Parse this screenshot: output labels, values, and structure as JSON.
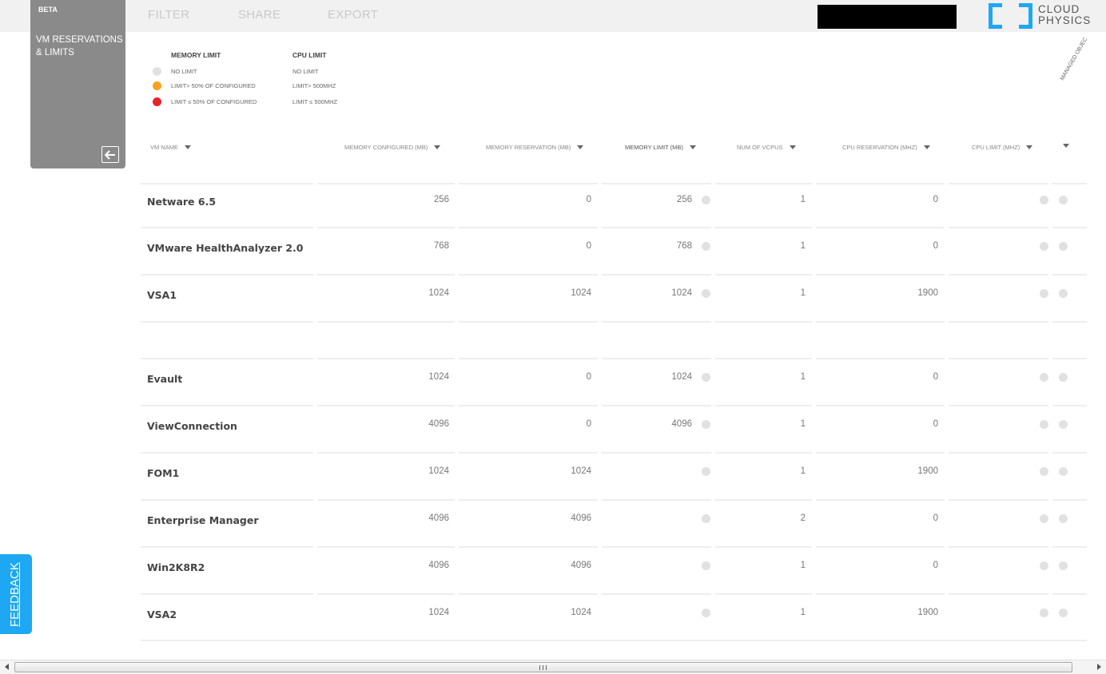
{
  "nav": {
    "filter": "FILTER",
    "share": "SHARE",
    "export": "EXPORT"
  },
  "logo": {
    "line1": "CLOUD",
    "line2": "PHYSICS",
    "color": "#1ea7f2"
  },
  "panel": {
    "badge": "BETA",
    "title": "VM RESERVATIONS & LIMITS"
  },
  "legend": {
    "memory_heading": "MEMORY LIMIT",
    "cpu_heading": "CPU LIMIT",
    "rows": [
      {
        "color": "#e1e1e1",
        "memory": "NO LIMIT",
        "cpu": "NO LIMIT"
      },
      {
        "color": "#f5a31c",
        "memory": "LIMIT> 50% OF CONFIGURED",
        "cpu": "LIMIT> 500MHZ"
      },
      {
        "color": "#e8232a",
        "memory": "LIMIT ≤ 50% OF CONFIGURED",
        "cpu": "LIMIT ≤ 500MHZ"
      }
    ]
  },
  "columns": {
    "vm_name": "VM NAME",
    "mem_configured": "MEMORY CONFIGURED (MB)",
    "mem_reservation": "MEMORY RESERVATION (MB)",
    "mem_limit": "MEMORY LIMIT (MB)",
    "num_vcpus": "NUM OF VCPUS",
    "cpu_reservation": "CPU RESERVATION (MHZ)",
    "cpu_limit": "CPU LIMIT (MHZ)",
    "managed_object": "MANAGED OBJECT REFERENCE"
  },
  "rows": [
    {
      "name": "Netware 6.5",
      "mem_configured": "256",
      "mem_reservation": "0",
      "mem_limit": "256",
      "vcpus": "1",
      "cpu_reservation": "0"
    },
    {
      "name": "VMware HealthAnalyzer 2.0",
      "mem_configured": "768",
      "mem_reservation": "0",
      "mem_limit": "768",
      "vcpus": "1",
      "cpu_reservation": "0"
    },
    {
      "name": "VSA1",
      "mem_configured": "1024",
      "mem_reservation": "1024",
      "mem_limit": "1024",
      "vcpus": "1",
      "cpu_reservation": "1900"
    },
    {
      "name": "",
      "mem_configured": "",
      "mem_reservation": "",
      "mem_limit": "",
      "vcpus": "",
      "cpu_reservation": ""
    },
    {
      "name": "Evault",
      "mem_configured": "1024",
      "mem_reservation": "0",
      "mem_limit": "1024",
      "vcpus": "1",
      "cpu_reservation": "0"
    },
    {
      "name": "ViewConnection",
      "mem_configured": "4096",
      "mem_reservation": "0",
      "mem_limit": "4096",
      "vcpus": "1",
      "cpu_reservation": "0"
    },
    {
      "name": "FOM1",
      "mem_configured": "1024",
      "mem_reservation": "1024",
      "mem_limit": "",
      "vcpus": "1",
      "cpu_reservation": "1900"
    },
    {
      "name": "Enterprise Manager",
      "mem_configured": "4096",
      "mem_reservation": "4096",
      "mem_limit": "",
      "vcpus": "2",
      "cpu_reservation": "0"
    },
    {
      "name": "Win2K8R2",
      "mem_configured": "4096",
      "mem_reservation": "4096",
      "mem_limit": "",
      "vcpus": "1",
      "cpu_reservation": "0"
    },
    {
      "name": "VSA2",
      "mem_configured": "1024",
      "mem_reservation": "1024",
      "mem_limit": "",
      "vcpus": "1",
      "cpu_reservation": "1900"
    }
  ],
  "feedback": "FEEDBACK",
  "icons": {
    "collapse": "arrow-left-icon",
    "sort": "caret-down-icon"
  }
}
